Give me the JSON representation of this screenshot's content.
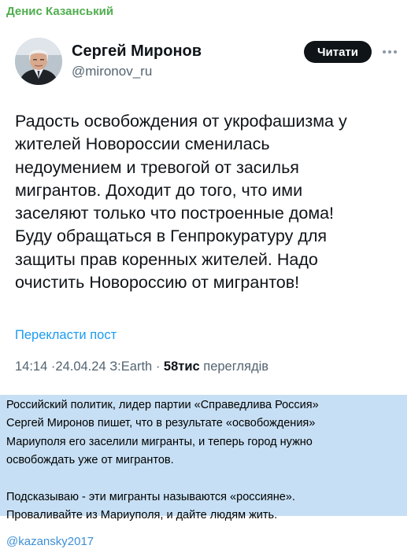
{
  "channel": {
    "name": "Денис Казанський",
    "footer_link": "@kazansky2017"
  },
  "tweet": {
    "author_name": "Сергей Миронов",
    "author_handle": "@mironov_ru",
    "follow_label": "Читати",
    "text_lines": [
      "Радость освобождения от укрофашизма у",
      "жителей Новороссии сменилась",
      "недоумением и тревогой от засилья",
      "мигрантов. Доходит до того, что ими",
      "заселяют только что построенные дома!",
      "Буду обращаться в Генпрокуратуру для",
      "защиты прав коренных жителей. Надо",
      "очистить Новороссию от мигрантов!"
    ],
    "translate_label": "Перекласти пост",
    "time": "14:14",
    "date": "24.04.24",
    "source": "З:Earth",
    "views_count": "58тис",
    "views_label": "переглядів",
    "separator": "·"
  },
  "comment": {
    "paragraph1_lines": [
      "Российский политик, лидер партии «Справедлива Россия»",
      "Сергей Миронов пишет, что в результате «освобождения»",
      "Мариуполя его заселили мигранты, и теперь город нужно",
      "освобождать уже от мигрантов."
    ],
    "paragraph2_lines": [
      "Подсказываю - эти мигранты называются «россияне».",
      "Проваливайте из Мариуполя, и дайте людям жить."
    ]
  },
  "icons": {
    "avatar": "avatar-portrait",
    "more": "more-horizontal-icon"
  },
  "colors": {
    "channel_name": "#4fae4e",
    "link": "#1d9bf0",
    "follow_bg": "#0f1419",
    "comment_bg": "#c6dff4",
    "footer_link": "#3d8fd6"
  }
}
